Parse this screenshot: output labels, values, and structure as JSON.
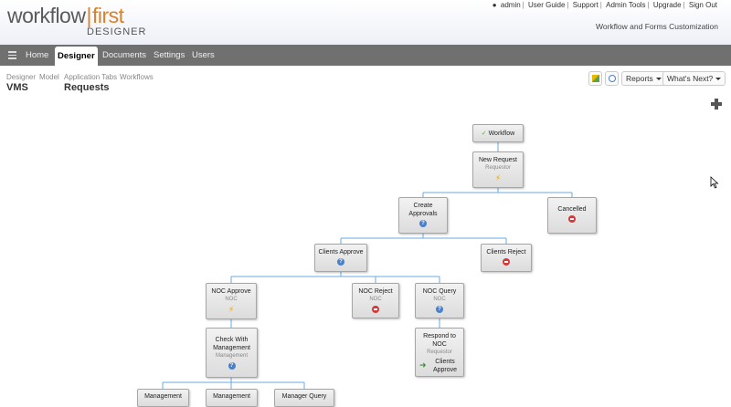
{
  "app": {
    "logo_word1": "workflow",
    "logo_word2": "first",
    "logo_sub": "DESIGNER",
    "tagline": "Workflow and Forms Customization"
  },
  "toplinks": {
    "user": "admin",
    "items": [
      "User Guide",
      "Support",
      "Admin Tools",
      "Upgrade",
      "Sign Out"
    ]
  },
  "nav": {
    "items": [
      "Home",
      "Designer",
      "Documents",
      "Settings",
      "Users"
    ],
    "active": "Designer"
  },
  "breadcrumb": {
    "designer": "Designer",
    "model": "Model",
    "app_tabs": "Application Tabs",
    "workflows": "Workflows",
    "vms": "VMS",
    "requests": "Requests"
  },
  "toolbar": {
    "reports": "Reports",
    "whats_next": "What's Next?"
  },
  "nodes": {
    "workflow": {
      "title": "Workflow"
    },
    "new_request": {
      "title": "New Request",
      "role": "Requestor"
    },
    "create_approvals": {
      "title": "Create Approvals"
    },
    "cancelled": {
      "title": "Cancelled"
    },
    "clients_approve": {
      "title": "Clients Approve"
    },
    "clients_reject": {
      "title": "Clients Reject"
    },
    "noc_approve": {
      "title": "NOC Approve",
      "role": "NOC"
    },
    "noc_reject": {
      "title": "NOC Reject",
      "role": "NOC"
    },
    "noc_query": {
      "title": "NOC Query",
      "role": "NOC"
    },
    "check_mgmt": {
      "title": "Check With Management",
      "role": "Management"
    },
    "respond_noc": {
      "title": "Respond to NOC",
      "role": "Requestor",
      "link": "Clients Approve"
    },
    "mgmt1": {
      "title": "Management"
    },
    "mgmt2": {
      "title": "Management"
    },
    "mgmt_query": {
      "title": "Manager Query"
    }
  },
  "colors": {
    "nav_bg": "#707070",
    "accent": "#d9822b",
    "wire": "#6aa9e0"
  }
}
